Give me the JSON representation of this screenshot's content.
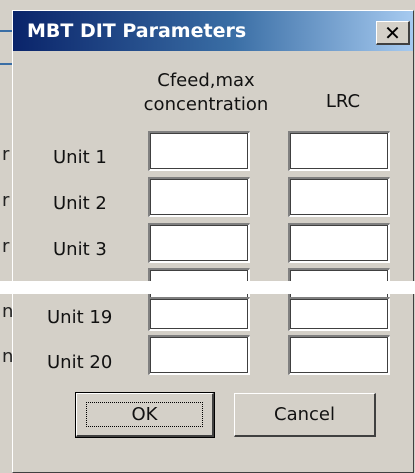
{
  "dialog": {
    "title": "MBT DIT Parameters",
    "close_glyph": "✕"
  },
  "columns": {
    "cfeed_line1": "Cfeed,max",
    "cfeed_line2": "concentration",
    "lrc": "LRC"
  },
  "rows": [
    {
      "label": "Unit 1",
      "cfeed": "",
      "lrc": ""
    },
    {
      "label": "Unit 2",
      "cfeed": "",
      "lrc": ""
    },
    {
      "label": "Unit 3",
      "cfeed": "",
      "lrc": ""
    },
    {
      "label": "",
      "cfeed": "",
      "lrc": ""
    },
    {
      "label": "Unit 19",
      "cfeed": "",
      "lrc": ""
    },
    {
      "label": "Unit 20",
      "cfeed": "",
      "lrc": ""
    }
  ],
  "buttons": {
    "ok": "OK",
    "cancel": "Cancel"
  },
  "background": {
    "ticks": [
      "r",
      "r",
      "r",
      "n",
      "n"
    ]
  },
  "colors": {
    "title_gradient_start": "#0a246a",
    "title_gradient_end": "#a6caf0",
    "dialog_face": "#d4d0c8"
  }
}
